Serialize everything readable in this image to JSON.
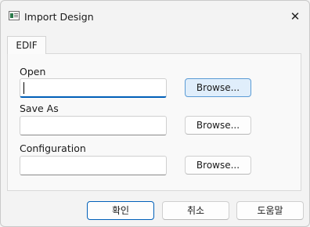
{
  "window": {
    "title": "Import Design",
    "icon": "app-window-icon"
  },
  "tabs": [
    {
      "label": "EDIF",
      "selected": true
    }
  ],
  "fields": {
    "open": {
      "label": "Open",
      "value": "",
      "browse_label": "Browse..."
    },
    "save_as": {
      "label": "Save As",
      "value": "",
      "browse_label": "Browse..."
    },
    "configuration": {
      "label": "Configuration",
      "value": "",
      "browse_label": "Browse..."
    }
  },
  "footer": {
    "ok_label": "확인",
    "cancel_label": "취소",
    "help_label": "도움말"
  },
  "colors": {
    "accent": "#005fb8",
    "accent_hover_bg": "#e0eefb"
  }
}
